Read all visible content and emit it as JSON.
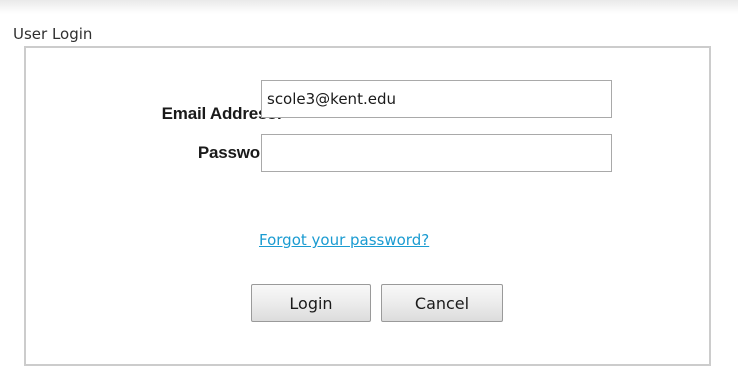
{
  "panel": {
    "title": "User Login"
  },
  "form": {
    "email_label": "Email Address:",
    "email_value": "scole3@kent.edu",
    "password_label": "Password:",
    "password_value": "",
    "forgot_link": "Forgot your password?",
    "login_label": "Login",
    "cancel_label": "Cancel"
  },
  "colors": {
    "link": "#1a9bd1",
    "border": "#cccccc"
  }
}
